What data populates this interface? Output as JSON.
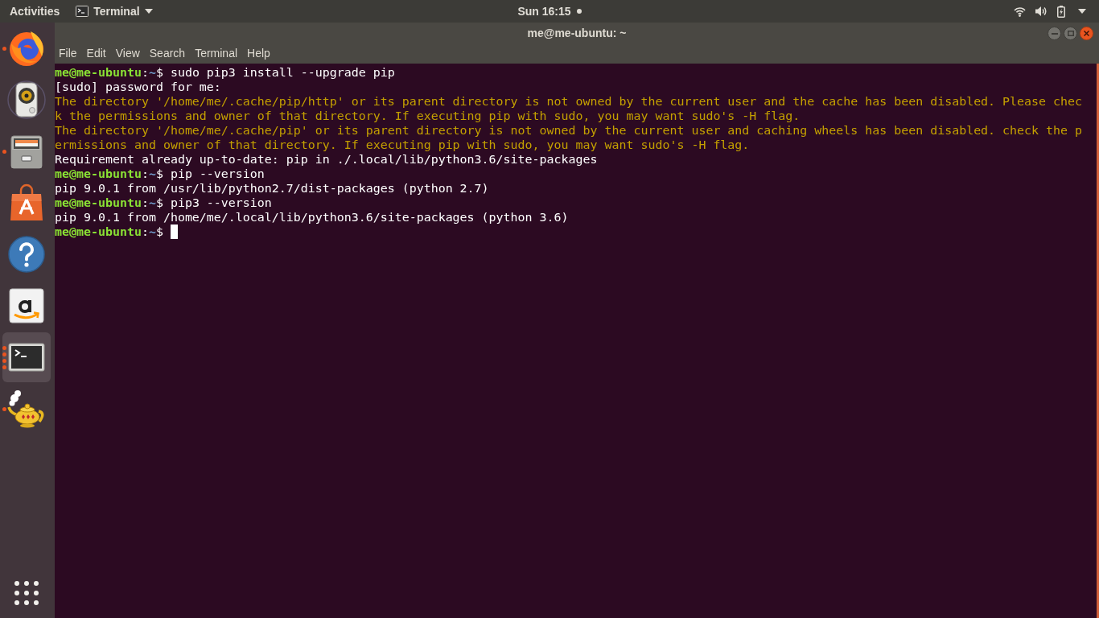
{
  "top_bar": {
    "activities": "Activities",
    "app_menu": "Terminal",
    "clock": "Sun 16:15",
    "notification": true
  },
  "dock": {
    "items": [
      {
        "kind": "browser",
        "running": true,
        "multiple_windows": false,
        "selected": false
      },
      {
        "kind": "music",
        "running": false,
        "multiple_windows": false,
        "selected": false
      },
      {
        "kind": "files",
        "running": true,
        "multiple_windows": false,
        "selected": false
      },
      {
        "kind": "software",
        "running": false,
        "multiple_windows": false,
        "selected": false
      },
      {
        "kind": "help",
        "running": false,
        "multiple_windows": false,
        "selected": false
      },
      {
        "kind": "store",
        "running": false,
        "multiple_windows": false,
        "selected": false
      },
      {
        "kind": "terminal",
        "running": true,
        "multiple_windows": true,
        "selected": true
      },
      {
        "kind": "lamp",
        "running": true,
        "multiple_windows": false,
        "selected": false
      }
    ]
  },
  "window": {
    "title": "me@me-ubuntu: ~",
    "menu": [
      "File",
      "Edit",
      "View",
      "Search",
      "Terminal",
      "Help"
    ]
  },
  "terminal": {
    "lines": [
      {
        "kind": "prompt",
        "user_host": "me@me-ubuntu",
        "colon": ":",
        "path": "~",
        "dollar": "$",
        "command": "sudo pip3 install --upgrade pip",
        "cursor": false
      },
      {
        "kind": "output",
        "text": "[sudo] password for me:"
      },
      {
        "kind": "warning",
        "text": "The directory '/home/me/.cache/pip/http' or its parent directory is not owned by the current user and the cache has been disabled. Please chec"
      },
      {
        "kind": "warning",
        "text": "k the permissions and owner of that directory. If executing pip with sudo, you may want sudo's -H flag."
      },
      {
        "kind": "warning",
        "text": "The directory '/home/me/.cache/pip' or its parent directory is not owned by the current user and caching wheels has been disabled. check the p"
      },
      {
        "kind": "warning",
        "text": "ermissions and owner of that directory. If executing pip with sudo, you may want sudo's -H flag."
      },
      {
        "kind": "output",
        "text": "Requirement already up-to-date: pip in ./.local/lib/python3.6/site-packages"
      },
      {
        "kind": "prompt",
        "user_host": "me@me-ubuntu",
        "colon": ":",
        "path": "~",
        "dollar": "$",
        "command": "pip --version",
        "cursor": false
      },
      {
        "kind": "output",
        "text": "pip 9.0.1 from /usr/lib/python2.7/dist-packages (python 2.7)"
      },
      {
        "kind": "prompt",
        "user_host": "me@me-ubuntu",
        "colon": ":",
        "path": "~",
        "dollar": "$",
        "command": "pip3 --version",
        "cursor": false
      },
      {
        "kind": "output",
        "text": "pip 9.0.1 from /home/me/.local/lib/python3.6/site-packages (python 3.6)"
      },
      {
        "kind": "prompt",
        "user_host": "me@me-ubuntu",
        "colon": ":",
        "path": "~",
        "dollar": "$",
        "cursor": true
      }
    ]
  }
}
